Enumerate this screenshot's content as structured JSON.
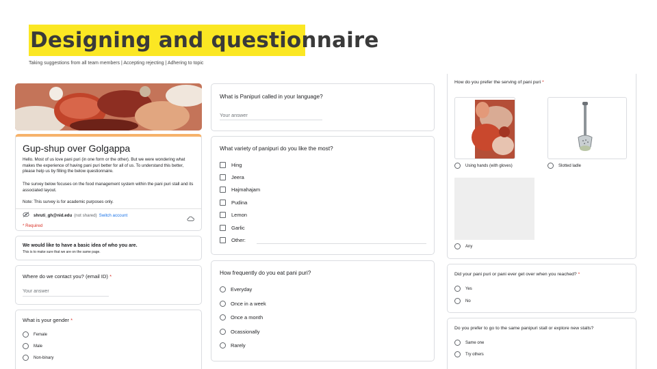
{
  "slide": {
    "title": "Designing and questionnaire",
    "subtitle": "Taking suggestions from all team members | Accepting rejecting | Adhering to topic"
  },
  "form": {
    "title": "Gup-shup over Golgappa",
    "description": "Hello. Most of us love pani puri (in one form or the other). But we were wondering what makes the experience of having pani puri better for all of us. To understand this better, please help us by filling the below questionnaire.",
    "description2": "The survey below focuses on the food management system within the pani puri stall and its associated layout.",
    "note": "Note: This survey is for academic purposes only.",
    "account_email": "shruti_gh@nid.edu",
    "account_shared": "(not shared)",
    "switch_account": "Switch account",
    "required": "* Required"
  },
  "section": {
    "title": "We would like to have a basic idea of who you are.",
    "desc": "This is to make sure that we are on the same page."
  },
  "q_contact": {
    "label": "Where do we contact you? (email ID)",
    "star": "*",
    "placeholder": "Your answer"
  },
  "q_gender": {
    "label": "What is your gender",
    "star": "*",
    "options": [
      "Female",
      "Male",
      "Non-binary"
    ]
  },
  "q_name": {
    "label": "What is Panipuri called in your language?",
    "placeholder": "Your answer"
  },
  "q_variety": {
    "label": "What variety of panipuri do you like the most?",
    "options": [
      "Hing",
      "Jeera",
      "Hajmahajam",
      "Pudina",
      "Lemon",
      "Garlic",
      "Other:"
    ]
  },
  "q_freq": {
    "label": "How frequently do you eat pani puri?",
    "options": [
      "Everyday",
      "Once in a week",
      "Once a month",
      "Ocassionally",
      "Rarely"
    ]
  },
  "q_serving": {
    "label": "How do you prefer the serving of pani puri",
    "star": "*",
    "options": [
      "Using hands (with gloves)",
      "Slotted ladle",
      "Any"
    ]
  },
  "q_overflow": {
    "label": "Did your pani puri or pani ever get over when you reached?",
    "star": "*",
    "options": [
      "Yes",
      "No"
    ]
  },
  "q_stall": {
    "label": "Do you prefer to go to the same panipuri stall or explore new stalls?",
    "options": [
      "Same one",
      "Try others"
    ]
  },
  "colors": {
    "highlight": "#fbe723",
    "accent": "#f6b26b",
    "required": "#d93025",
    "link": "#1a73e8"
  }
}
